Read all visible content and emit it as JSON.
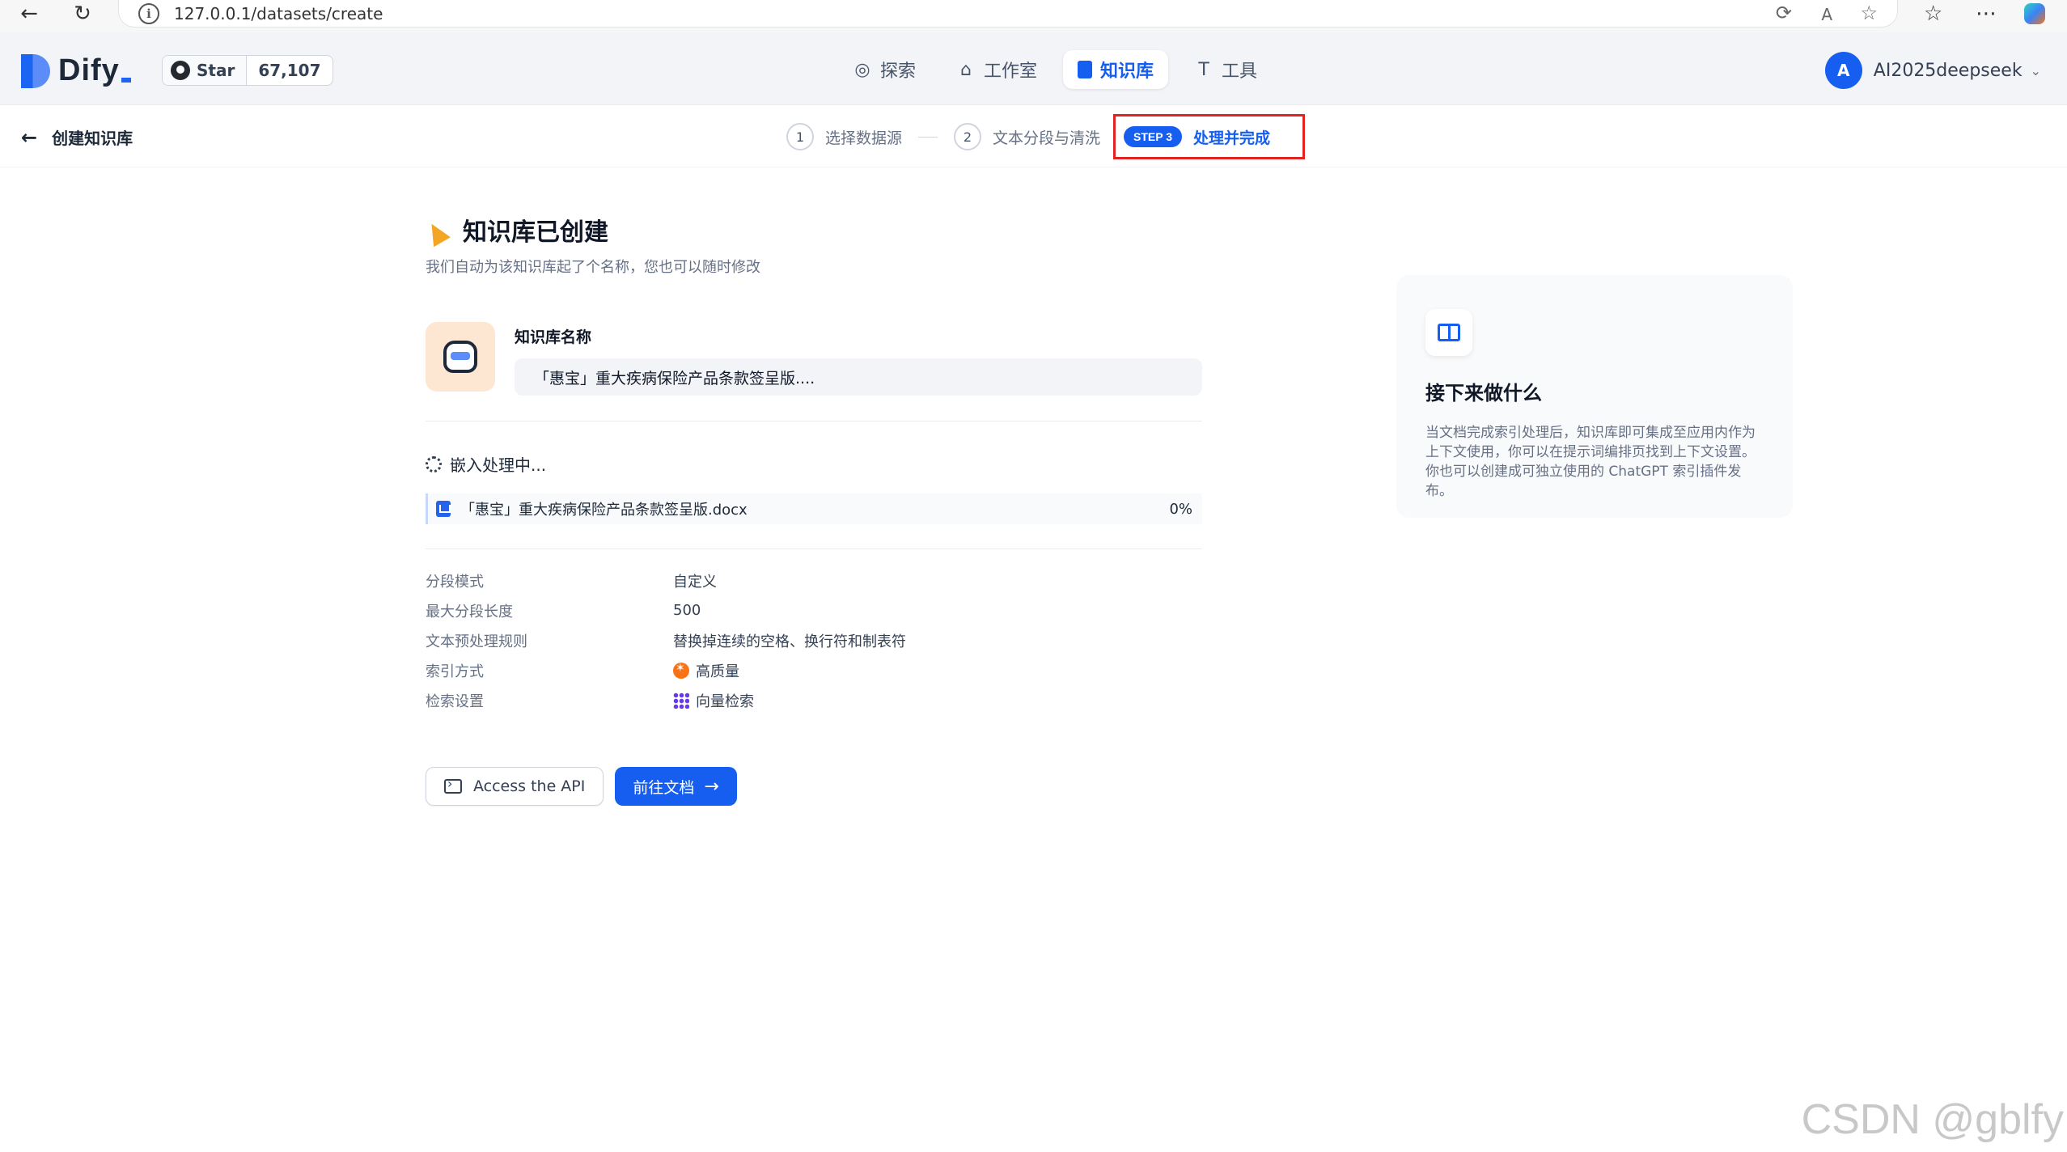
{
  "browser": {
    "url": "127.0.0.1/datasets/create"
  },
  "header": {
    "logo_text": "Dify",
    "github": {
      "star_label": "Star",
      "star_count": "67,107"
    },
    "nav": [
      {
        "label": "探索",
        "icon": "compass-icon"
      },
      {
        "label": "工作室",
        "icon": "robot-icon"
      },
      {
        "label": "知识库",
        "icon": "book-icon",
        "active": true
      },
      {
        "label": "工具",
        "icon": "hammer-icon"
      }
    ],
    "user": {
      "avatar_letter": "A",
      "name": "AI2025deepseek"
    }
  },
  "stepbar": {
    "back_label": "创建知识库",
    "steps": [
      {
        "num": "1",
        "label": "选择数据源"
      },
      {
        "num": "2",
        "label": "文本分段与清洗"
      }
    ],
    "active_step": {
      "badge": "STEP 3",
      "label": "处理并完成"
    }
  },
  "main": {
    "title": "知识库已创建",
    "subtitle": "我们自动为该知识库起了个名称，您也可以随时修改",
    "name_label": "知识库名称",
    "name_value": "「惠宝」重大疾病保险产品条款签呈版....",
    "embedding_status": "嵌入处理中...",
    "file": {
      "name": "「惠宝」重大疾病保险产品条款签呈版.docx",
      "progress": "0%"
    },
    "properties": [
      {
        "key": "分段模式",
        "value": "自定义"
      },
      {
        "key": "最大分段长度",
        "value": "500"
      },
      {
        "key": "文本预处理规则",
        "value": "替换掉连续的空格、换行符和制表符"
      },
      {
        "key": "索引方式",
        "value": "高质量",
        "icon": "high-quality-icon"
      },
      {
        "key": "检索设置",
        "value": "向量检索",
        "icon": "vector-grid-icon"
      }
    ],
    "api_button": "Access the API",
    "doc_button": "前往文档"
  },
  "side": {
    "title": "接下来做什么",
    "text": "当文档完成索引处理后，知识库即可集成至应用内作为上下文使用，你可以在提示词编排页找到上下文设置。你也可以创建成可独立使用的 ChatGPT 索引插件发布。"
  },
  "watermark": "CSDN @gblfy",
  "colors": {
    "primary": "#155eef",
    "highlight_border": "#e02424"
  }
}
